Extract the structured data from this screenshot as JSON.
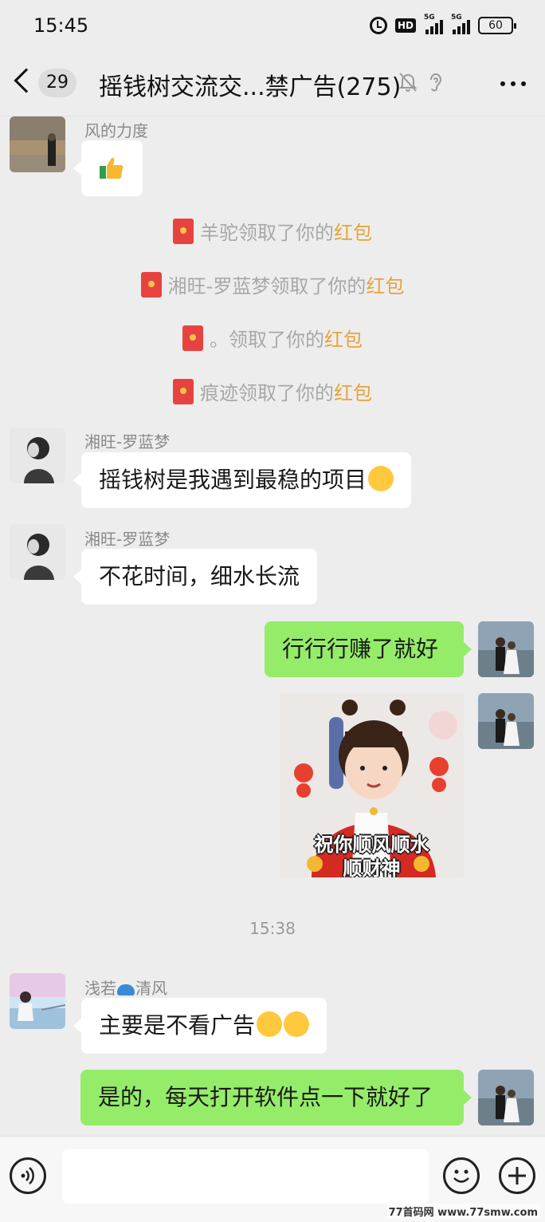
{
  "status_bar": {
    "time": "15:45",
    "hd": "HD",
    "net1": "5G",
    "net2": "5G",
    "battery": "60"
  },
  "header": {
    "unread_count": "29",
    "title": "摇钱树交流交...禁广告(275)",
    "icons": [
      "back-icon",
      "mute-icon",
      "ear-icon",
      "more-icon"
    ]
  },
  "messages": [
    {
      "sender": "风的力度"
    },
    {
      "system": {
        "name": "羊驼",
        "action": "领取了你的",
        "link": "红包"
      }
    },
    {
      "system": {
        "name": "湘旺-罗蓝梦",
        "action": "领取了你的",
        "link": "红包"
      }
    },
    {
      "system": {
        "name": "。",
        "action": "领取了你的",
        "link": "红包"
      }
    },
    {
      "system": {
        "name": "痕迹",
        "action": "领取了你的",
        "link": "红包"
      }
    },
    {
      "sender": "湘旺-罗蓝梦",
      "text": "摇钱树是我遇到最稳的项目"
    },
    {
      "sender": "湘旺-罗蓝梦",
      "text": "不花时间，细水长流"
    },
    {
      "text": "行行行赚了就好"
    },
    {
      "sticker_line1": "祝你顺风顺水",
      "sticker_line2": "顺财神"
    },
    {
      "timestamp": "15:38"
    },
    {
      "sender_a": "浅若",
      "sender_b": "清风",
      "text": "主要是不看广告"
    },
    {
      "text": "是的，每天打开软件点一下就好了"
    }
  ],
  "watermark": "77首码网 www.77smw.com",
  "colors": {
    "self_bubble": "#95ec69",
    "red_packet": "#e64340",
    "red_packet_link": "#e8a33a"
  }
}
